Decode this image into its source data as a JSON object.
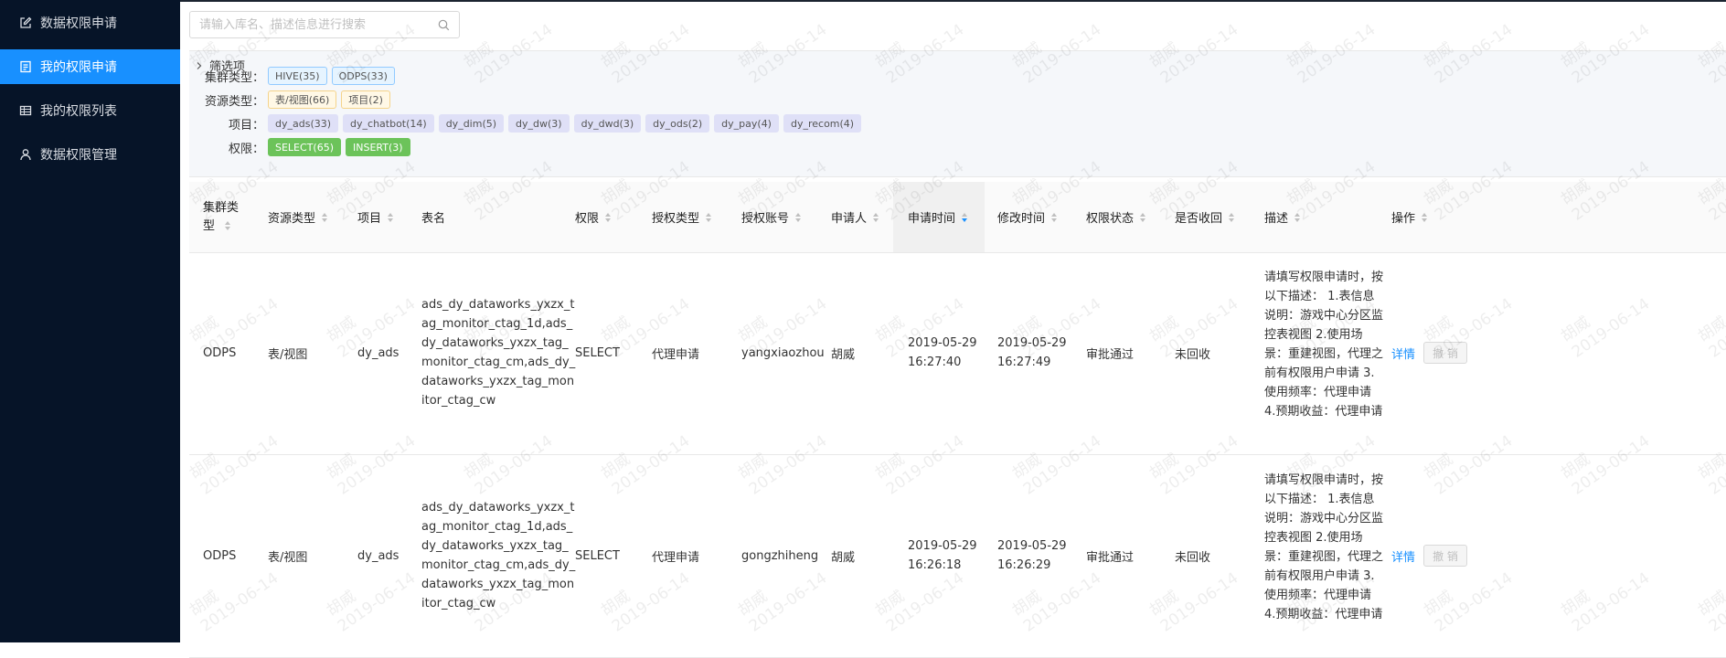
{
  "sidebar": {
    "items": [
      {
        "label": "数据权限申请",
        "icon": "edit-icon",
        "active": false
      },
      {
        "label": "我的权限申请",
        "icon": "document-icon",
        "active": true
      },
      {
        "label": "我的权限列表",
        "icon": "table-icon",
        "active": false
      },
      {
        "label": "数据权限管理",
        "icon": "user-icon",
        "active": false
      }
    ]
  },
  "search": {
    "placeholder": "请输入库名、描述信息进行搜索",
    "value": ""
  },
  "filter": {
    "title": "筛选项",
    "cluster_label": "集群类型：",
    "cluster_tags": [
      "HIVE(35)",
      "ODPS(33)"
    ],
    "resource_label": "资源类型：",
    "resource_tags": [
      "表/视图(66)",
      "项目(2)"
    ],
    "project_label": "项目：",
    "project_tags": [
      "dy_ads(33)",
      "dy_chatbot(14)",
      "dy_dim(5)",
      "dy_dw(3)",
      "dy_dwd(3)",
      "dy_ods(2)",
      "dy_pay(4)",
      "dy_recom(4)"
    ],
    "perm_label": "权限：",
    "perm_tags": [
      "SELECT(65)",
      "INSERT(3)"
    ]
  },
  "table": {
    "columns": {
      "cluster": "集群类型",
      "resource": "资源类型",
      "project": "项目",
      "table": "表名",
      "perm": "权限",
      "auth_type": "授权类型",
      "account": "授权账号",
      "applicant": "申请人",
      "apply_time": "申请时间",
      "modify_time": "修改时间",
      "status": "权限状态",
      "revoked": "是否收回",
      "desc": "描述",
      "action": "操作"
    },
    "rows": [
      {
        "cluster": "ODPS",
        "resource": "表/视图",
        "project": "dy_ads",
        "table": "ads_dy_dataworks_yxzx_tag_monitor_ctag_1d,ads_dy_dataworks_yxzx_tag_monitor_ctag_cm,ads_dy_dataworks_yxzx_tag_monitor_ctag_cw",
        "perm": "SELECT",
        "auth_type": "代理申请",
        "account": "yangxiaozhou",
        "applicant": "胡威",
        "apply_time_date": "2019-05-29",
        "apply_time_clock": "16:27:40",
        "modify_time_date": "2019-05-29",
        "modify_time_clock": "16:27:49",
        "status": "审批通过",
        "revoked": "未回收",
        "desc": "请填写权限申请时，按以下描述： 1.表信息说明：游戏中心分区监控表视图 2.使用场景：重建视图，代理之前有权限用户申请 3.使用频率：代理申请 4.预期收益：代理申请",
        "detail": "详情",
        "revoke": "撤 销"
      },
      {
        "cluster": "ODPS",
        "resource": "表/视图",
        "project": "dy_ads",
        "table": "ads_dy_dataworks_yxzx_tag_monitor_ctag_1d,ads_dy_dataworks_yxzx_tag_monitor_ctag_cm,ads_dy_dataworks_yxzx_tag_monitor_ctag_cw",
        "perm": "SELECT",
        "auth_type": "代理申请",
        "account": "gongzhiheng",
        "applicant": "胡威",
        "apply_time_date": "2019-05-29",
        "apply_time_clock": "16:26:18",
        "modify_time_date": "2019-05-29",
        "modify_time_clock": "16:26:29",
        "status": "审批通过",
        "revoked": "未回收",
        "desc": "请填写权限申请时，按以下描述： 1.表信息说明：游戏中心分区监控表视图 2.使用场景：重建视图，代理之前有权限用户申请 3.使用频率：代理申请 4.预期收益：代理申请",
        "detail": "详情",
        "revoke": "撤 销"
      }
    ]
  },
  "watermark": {
    "name": "胡威",
    "date": "2019-06-14"
  },
  "colors": {
    "sidebar_bg": "#061428",
    "accent": "#1890ff",
    "green_tag": "#6cc35a"
  }
}
